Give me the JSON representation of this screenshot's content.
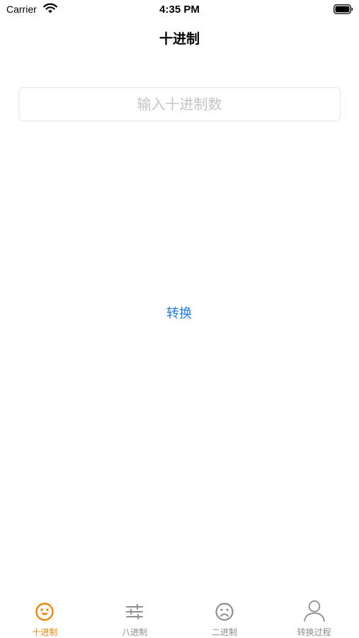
{
  "status_bar": {
    "carrier": "Carrier",
    "time": "4:35 PM"
  },
  "nav": {
    "title": "十进制"
  },
  "input": {
    "placeholder": "输入十进制数",
    "value": ""
  },
  "convert_button": {
    "label": "转换"
  },
  "tab_bar": {
    "tabs": [
      {
        "label": "十进制",
        "icon": "smiley-face-icon",
        "active": true
      },
      {
        "label": "八进制",
        "icon": "sliders-icon",
        "active": false
      },
      {
        "label": "二进制",
        "icon": "sad-face-icon",
        "active": false
      },
      {
        "label": "转换过程",
        "icon": "person-icon",
        "active": false
      }
    ]
  },
  "colors": {
    "accent": "#f2870b",
    "inactive": "#8e8e93",
    "link": "#1a7cf5",
    "placeholder": "#c4c4c6"
  }
}
